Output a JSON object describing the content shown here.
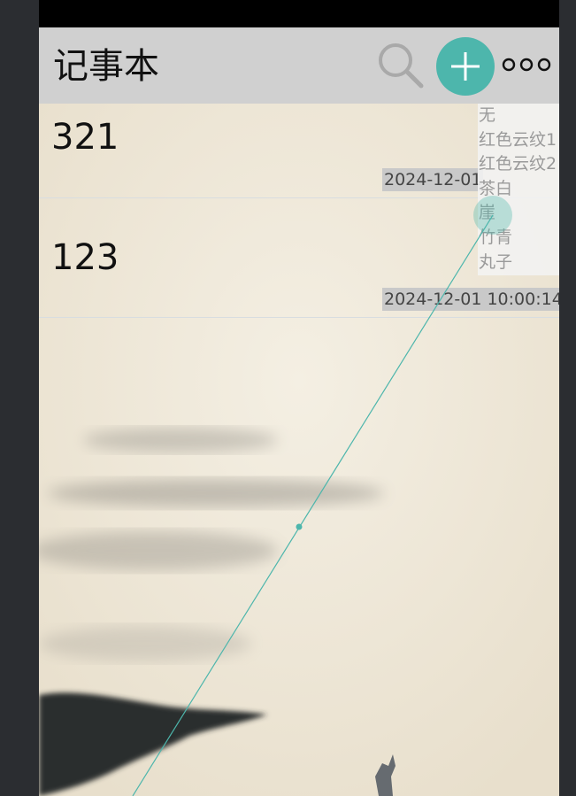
{
  "app": {
    "title": "记事本"
  },
  "toolbar": {
    "search_icon": "search-icon",
    "add_icon": "plus-icon",
    "more_icon": "more-dots-icon",
    "accent_color": "#4db6ac",
    "appbar_color": "#d0d0d0"
  },
  "notes": [
    {
      "title": "321",
      "date": "2024-12-01"
    },
    {
      "title": "123",
      "date": "2024-12-01 10:00:14"
    }
  ],
  "color_menu": {
    "items": [
      "无",
      "红色云纹1",
      "红色云纹2",
      "茶白",
      "崖",
      "竹青",
      "丸子"
    ]
  }
}
